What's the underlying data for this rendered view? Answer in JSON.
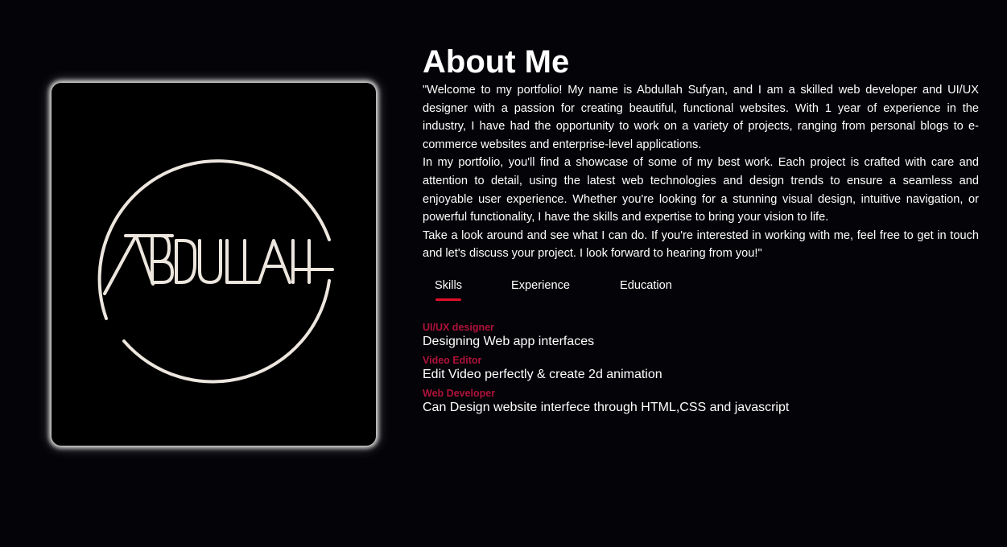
{
  "about": {
    "heading": "About Me",
    "paragraphs": [
      "\"Welcome to my portfolio! My name is Abdullah Sufyan, and I am a skilled web developer and UI/UX designer with a passion for creating beautiful, functional websites. With 1 year of experience in the industry, I have had the opportunity to work on a variety of projects, ranging from personal blogs to e-commerce websites and enterprise-level applications.",
      "In my portfolio, you'll find a showcase of some of my best work. Each project is crafted with care and attention to detail, using the latest web technologies and design trends to ensure a seamless and enjoyable user experience. Whether you're looking for a stunning visual design, intuitive navigation, or powerful functionality, I have the skills and expertise to bring your vision to life.",
      "Take a look around and see what I can do. If you're interested in working with me, feel free to get in touch and let's discuss your project. I look forward to hearing from you!\""
    ]
  },
  "logo": {
    "text": "ABDULLAH"
  },
  "tabs": [
    {
      "label": "Skills",
      "active": true
    },
    {
      "label": "Experience",
      "active": false
    },
    {
      "label": "Education",
      "active": false
    }
  ],
  "skills": [
    {
      "title": "UI/UX designer",
      "description": "Designing Web app interfaces"
    },
    {
      "title": "Video Editor",
      "description": "Edit Video perfectly & create 2d animation"
    },
    {
      "title": "Web Developer",
      "description": "Can Design website interfece through HTML,CSS and javascript"
    }
  ],
  "colors": {
    "background": "#040408",
    "accent": "#e0102c",
    "skill_title": "#b0123a",
    "logo_stroke": "#ece6de"
  }
}
